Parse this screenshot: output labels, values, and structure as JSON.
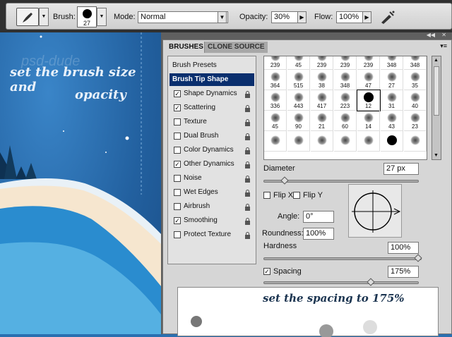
{
  "options_bar": {
    "brush_label": "Brush:",
    "brush_size": "27",
    "mode_label": "Mode:",
    "mode_value": "Normal",
    "opacity_label": "Opacity:",
    "opacity_value": "30%",
    "flow_label": "Flow:",
    "flow_value": "100%"
  },
  "canvas": {
    "watermark": "psd-dude",
    "line1": "set the brush size and",
    "line2": "opacity"
  },
  "panel": {
    "tabs": [
      {
        "label": "BRUSHES"
      },
      {
        "label": "CLONE SOURCE"
      }
    ],
    "presets_label": "Brush Presets",
    "tip_shape_label": "Brush Tip Shape",
    "items": [
      {
        "label": "Shape Dynamics",
        "checked": true
      },
      {
        "label": "Scattering",
        "checked": true
      },
      {
        "label": "Texture",
        "checked": false
      },
      {
        "label": "Dual Brush",
        "checked": false
      },
      {
        "label": "Color Dynamics",
        "checked": false
      },
      {
        "label": "Other Dynamics",
        "checked": true
      },
      {
        "label": "Noise",
        "checked": false
      },
      {
        "label": "Wet Edges",
        "checked": false
      },
      {
        "label": "Airbrush",
        "checked": false
      },
      {
        "label": "Smoothing",
        "checked": true
      },
      {
        "label": "Protect Texture",
        "checked": false
      }
    ],
    "brush_grid": [
      [
        "239",
        "45",
        "239",
        "239",
        "239",
        "348",
        "348"
      ],
      [
        "364",
        "515",
        "38",
        "348",
        "47",
        "27",
        "35"
      ],
      [
        "336",
        "443",
        "417",
        "223",
        "12",
        "31",
        "40"
      ],
      [
        "45",
        "90",
        "21",
        "60",
        "14",
        "43",
        "23"
      ],
      [
        "",
        "",
        "",
        "",
        "",
        "",
        ""
      ]
    ],
    "diameter_label": "Diameter",
    "diameter_value": "27 px",
    "diameter_fraction": 0.12,
    "flip_x_label": "Flip X",
    "flip_y_label": "Flip Y",
    "angle_label": "Angle:",
    "angle_value": "0°",
    "roundness_label": "Roundness:",
    "roundness_value": "100%",
    "hardness_label": "Hardness",
    "hardness_value": "100%",
    "hardness_fraction": 1.0,
    "spacing_label": "Spacing",
    "spacing_value": "175%",
    "spacing_fraction": 0.7,
    "preview_caption": "set the spacing to 175%"
  }
}
